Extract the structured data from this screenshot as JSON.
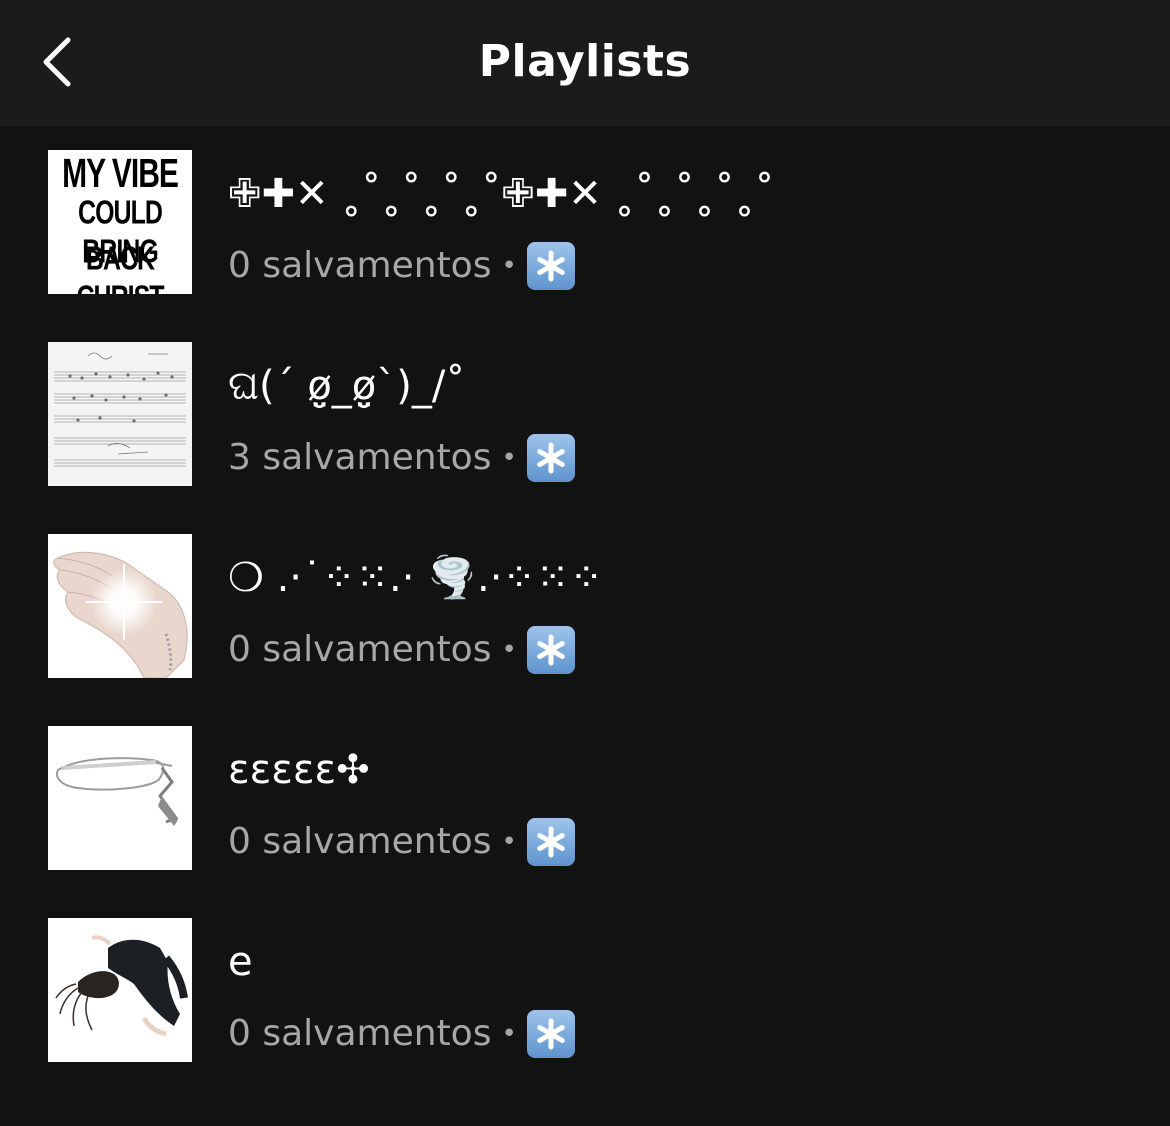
{
  "header": {
    "title": "Playlists",
    "back_icon": "chevron-left-icon"
  },
  "playlists": [
    {
      "name": "✙✚✕ ˳˚˳˚˳˚˳˚✙✚✕ ˳˚˳˚˳˚˳˚",
      "cover_text": [
        "MY VIBE",
        "COULD BRING",
        "BACK CHRIST"
      ],
      "saves": "0 salvamentos",
      "separator": "•",
      "badge_icon": "asterisk-icon"
    },
    {
      "name": "ଘ(´ ø̤̮_ø̤̮`)_/˚",
      "saves": "3 salvamentos",
      "separator": "•",
      "badge_icon": "asterisk-icon"
    },
    {
      "name": "❍ .·˙⁘⁙.· 🌪️.·⁘⁙⁘",
      "saves": "0 salvamentos",
      "separator": "•",
      "badge_icon": "asterisk-icon"
    },
    {
      "name": "ɛɛɛɛɛ✣",
      "saves": "0 salvamentos",
      "separator": "•",
      "badge_icon": "asterisk-icon"
    },
    {
      "name": "e",
      "saves": "0 salvamentos",
      "separator": "•",
      "badge_icon": "asterisk-icon"
    }
  ],
  "colors": {
    "background": "#121212",
    "header_background": "#1b1b1b",
    "secondary_text": "#a7a7a7",
    "badge_blue": "#6b9fd6"
  }
}
